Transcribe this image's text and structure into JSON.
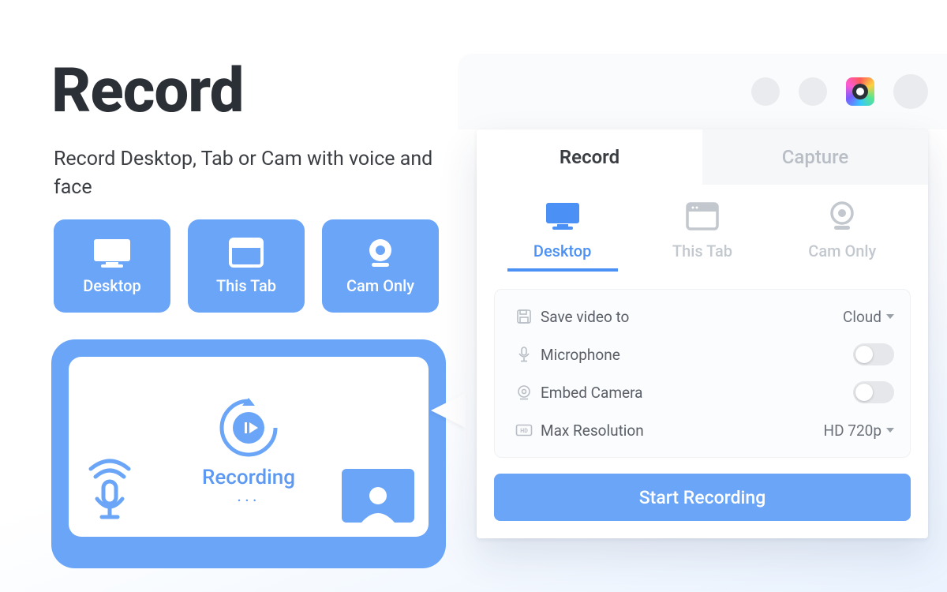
{
  "headline": "Record",
  "subhead": "Record Desktop, Tab or Cam with voice and face",
  "modes": [
    {
      "label": "Desktop",
      "icon": "monitor-icon"
    },
    {
      "label": "This Tab",
      "icon": "tab-icon"
    },
    {
      "label": "Cam Only",
      "icon": "camera-icon"
    }
  ],
  "preview": {
    "status": "Recording",
    "dots": "..."
  },
  "popup": {
    "tabs": {
      "record": "Record",
      "capture": "Capture"
    },
    "sources": [
      {
        "label": "Desktop",
        "icon": "monitor-icon",
        "active": true
      },
      {
        "label": "This Tab",
        "icon": "tab-icon",
        "active": false
      },
      {
        "label": "Cam Only",
        "icon": "camera-icon",
        "active": false
      }
    ],
    "settings": {
      "save": {
        "label": "Save video to",
        "value": "Cloud"
      },
      "mic": {
        "label": "Microphone",
        "on": false
      },
      "embed": {
        "label": "Embed Camera",
        "on": false
      },
      "res": {
        "label": "Max Resolution",
        "value": "HD 720p"
      }
    },
    "start": "Start Recording"
  }
}
